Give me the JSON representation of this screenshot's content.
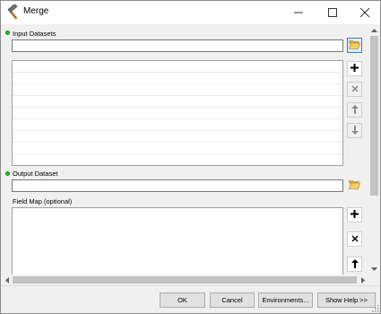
{
  "window": {
    "title": "Merge",
    "icon": "hammer-icon",
    "controls": [
      "minimize-icon",
      "maximize-icon",
      "close-icon"
    ]
  },
  "params": {
    "input_datasets": {
      "label": "Input Datasets",
      "required": true,
      "value": "",
      "items": []
    },
    "output_dataset": {
      "label": "Output Dataset",
      "required": true,
      "value": ""
    },
    "field_map": {
      "label": "Field Map (optional)",
      "required": false,
      "items": []
    }
  },
  "icons": {
    "browse": "folder-open-icon",
    "add": "plus-icon",
    "remove": "x-icon",
    "up": "arrow-up-icon",
    "down": "arrow-down-icon"
  },
  "colors": {
    "required_dot": "#22c322",
    "accent_border": "#3c7fb1"
  },
  "footer": {
    "ok": "OK",
    "cancel": "Cancel",
    "environments": "Environments...",
    "show_help": "Show Help >>"
  }
}
